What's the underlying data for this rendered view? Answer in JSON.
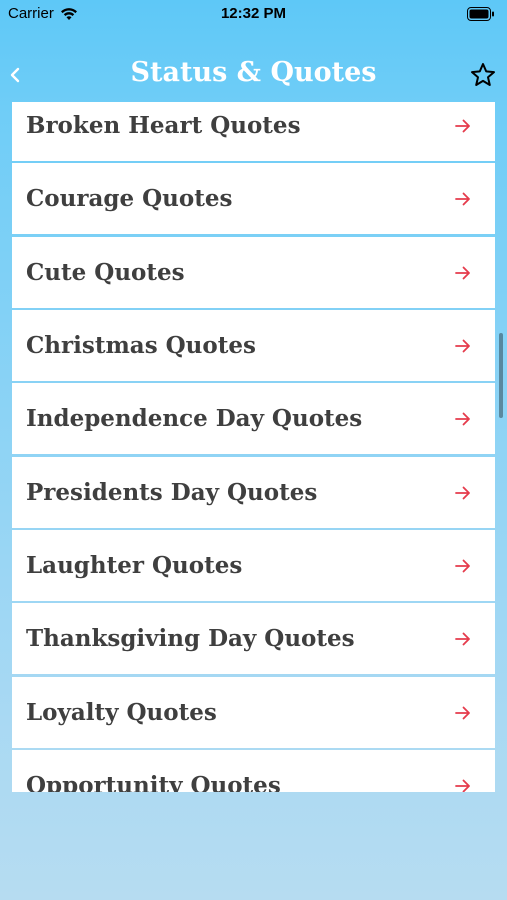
{
  "status_bar": {
    "carrier": "Carrier",
    "time": "12:32 PM"
  },
  "nav": {
    "title": "Status & Quotes",
    "back_icon": "chevron-left-icon",
    "favorite_icon": "star-outline-icon"
  },
  "list": {
    "arrow_color": "#e53b4c",
    "items": [
      {
        "label": "Broken Heart Quotes"
      },
      {
        "label": "Courage Quotes"
      },
      {
        "label": "Cute Quotes"
      },
      {
        "label": "Christmas Quotes"
      },
      {
        "label": "Independence Day Quotes"
      },
      {
        "label": "Presidents Day Quotes"
      },
      {
        "label": "Laughter Quotes"
      },
      {
        "label": "Thanksgiving Day Quotes"
      },
      {
        "label": "Loyalty Quotes"
      },
      {
        "label": "Opportunity Quotes"
      }
    ]
  }
}
